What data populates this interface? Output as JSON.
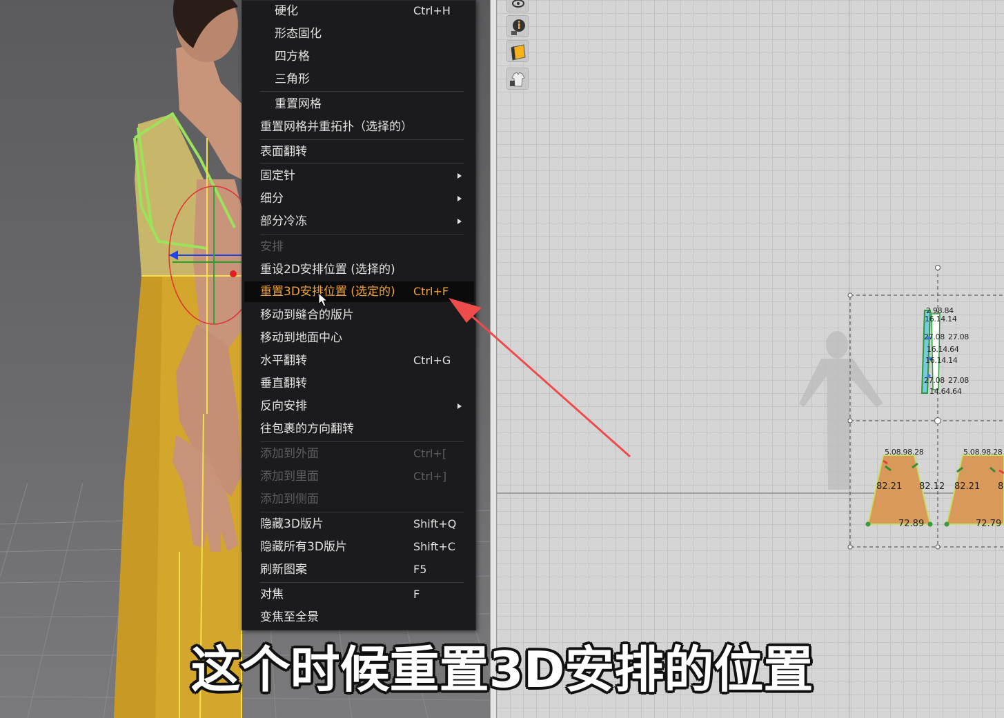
{
  "context_menu": {
    "items": [
      {
        "id": "harden",
        "label": "硬化",
        "shortcut": "Ctrl+H",
        "indent": true
      },
      {
        "id": "shape-solidify",
        "label": "形态固化",
        "indent": true
      },
      {
        "id": "quad",
        "label": "四方格",
        "indent": true
      },
      {
        "id": "triangle",
        "label": "三角形",
        "indent": true
      },
      {
        "id": "reset-mesh",
        "label": "重置网格",
        "indent": true
      },
      {
        "id": "reset-mesh-retopo",
        "label": "重置网格并重拓扑（选择的）"
      },
      {
        "id": "flip-surface",
        "label": "表面翻转"
      },
      {
        "id": "pin",
        "label": "固定针",
        "submenu": true
      },
      {
        "id": "subdivide",
        "label": "细分",
        "submenu": true
      },
      {
        "id": "partial-freeze",
        "label": "部分冷冻",
        "submenu": true
      },
      {
        "id": "arrange-header",
        "label": "安排",
        "disabled": true
      },
      {
        "id": "reset-2d-arrangement",
        "label": "重设2D安排位置 (选择的)"
      },
      {
        "id": "reset-3d-arrangement",
        "label": "重置3D安排位置 (选定的)",
        "shortcut": "Ctrl+F",
        "highlighted": true
      },
      {
        "id": "move-to-sewn",
        "label": "移动到缝合的版片"
      },
      {
        "id": "move-to-floor-center",
        "label": "移动到地面中心"
      },
      {
        "id": "flip-horizontal",
        "label": "水平翻转",
        "shortcut": "Ctrl+G"
      },
      {
        "id": "flip-vertical",
        "label": "垂直翻转"
      },
      {
        "id": "reverse-arrangement",
        "label": "反向安排",
        "submenu": true
      },
      {
        "id": "flip-wrap-direction",
        "label": "往包裹的方向翻转"
      },
      {
        "id": "add-to-outside",
        "label": "添加到外面",
        "shortcut": "Ctrl+[",
        "disabled": true
      },
      {
        "id": "add-to-inside",
        "label": "添加到里面",
        "shortcut": "Ctrl+]",
        "disabled": true
      },
      {
        "id": "add-to-side",
        "label": "添加到侧面",
        "disabled": true
      },
      {
        "id": "hide-3d-pieces",
        "label": "隐藏3D版片",
        "shortcut": "Shift+Q"
      },
      {
        "id": "hide-all-3d-pieces",
        "label": "隐藏所有3D版片",
        "shortcut": "Shift+C"
      },
      {
        "id": "refresh-pattern",
        "label": "刷新图案",
        "shortcut": "F5"
      },
      {
        "id": "focus",
        "label": "对焦",
        "shortcut": "F"
      },
      {
        "id": "zoom-to-fit",
        "label": "变焦至全景"
      }
    ]
  },
  "pattern_window": {
    "toolbar_icons": [
      "visibility-icon",
      "info-icon",
      "fabric-icon",
      "garment-lock-icon"
    ],
    "measurements": {
      "top_piece": [
        "2.98.84",
        "16.14.14",
        "27.08",
        "27.08",
        "16.14.64",
        "16.14.14",
        "27.08",
        "27.08",
        "14.64.64"
      ],
      "skirt_left": {
        "top": "5.08.98.28",
        "left": "82.21",
        "right": "82.12",
        "bottom": "72.89"
      },
      "skirt_right": {
        "top": "5.08.98.28",
        "left": "82.21",
        "right": "8",
        "bottom": "72.79"
      }
    }
  },
  "subtitle": "这个时候重置3D安排的位置",
  "colors": {
    "menu_bg": "#1b1b1d",
    "menu_text": "#e2e2e2",
    "menu_disabled": "#5d5d5f",
    "menu_highlight_text": "#f2a33b",
    "annotation_arrow": "#ee4b4b",
    "dress": "#d4a62c",
    "pattern_piece": "#d9995a",
    "selection_green": "#9be35a"
  }
}
